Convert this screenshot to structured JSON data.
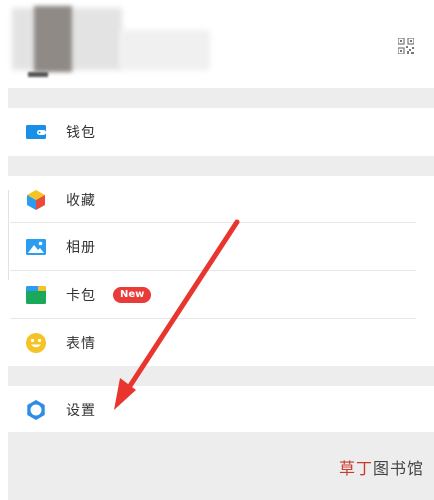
{
  "menu": {
    "wallet": "钱包",
    "favorites": "收藏",
    "album": "相册",
    "cards": "卡包",
    "new_badge": "New",
    "stickers": "表情",
    "settings": "设置"
  },
  "watermark": {
    "part1": "草丁",
    "part2": "图书馆"
  },
  "colors": {
    "wallet_icon": "#1a8fe8",
    "album_icon": "#2a9df0",
    "cards_icon": "#1aa85a",
    "stickers_icon": "#f6c325",
    "settings_icon": "#2d8ce6",
    "badge": "#e93b37",
    "arrow": "#e8352e"
  },
  "icons": [
    "qr-code-icon",
    "wallet-icon",
    "favorites-cube-icon",
    "album-image-icon",
    "card-icon",
    "smiley-icon",
    "settings-gear-icon"
  ]
}
